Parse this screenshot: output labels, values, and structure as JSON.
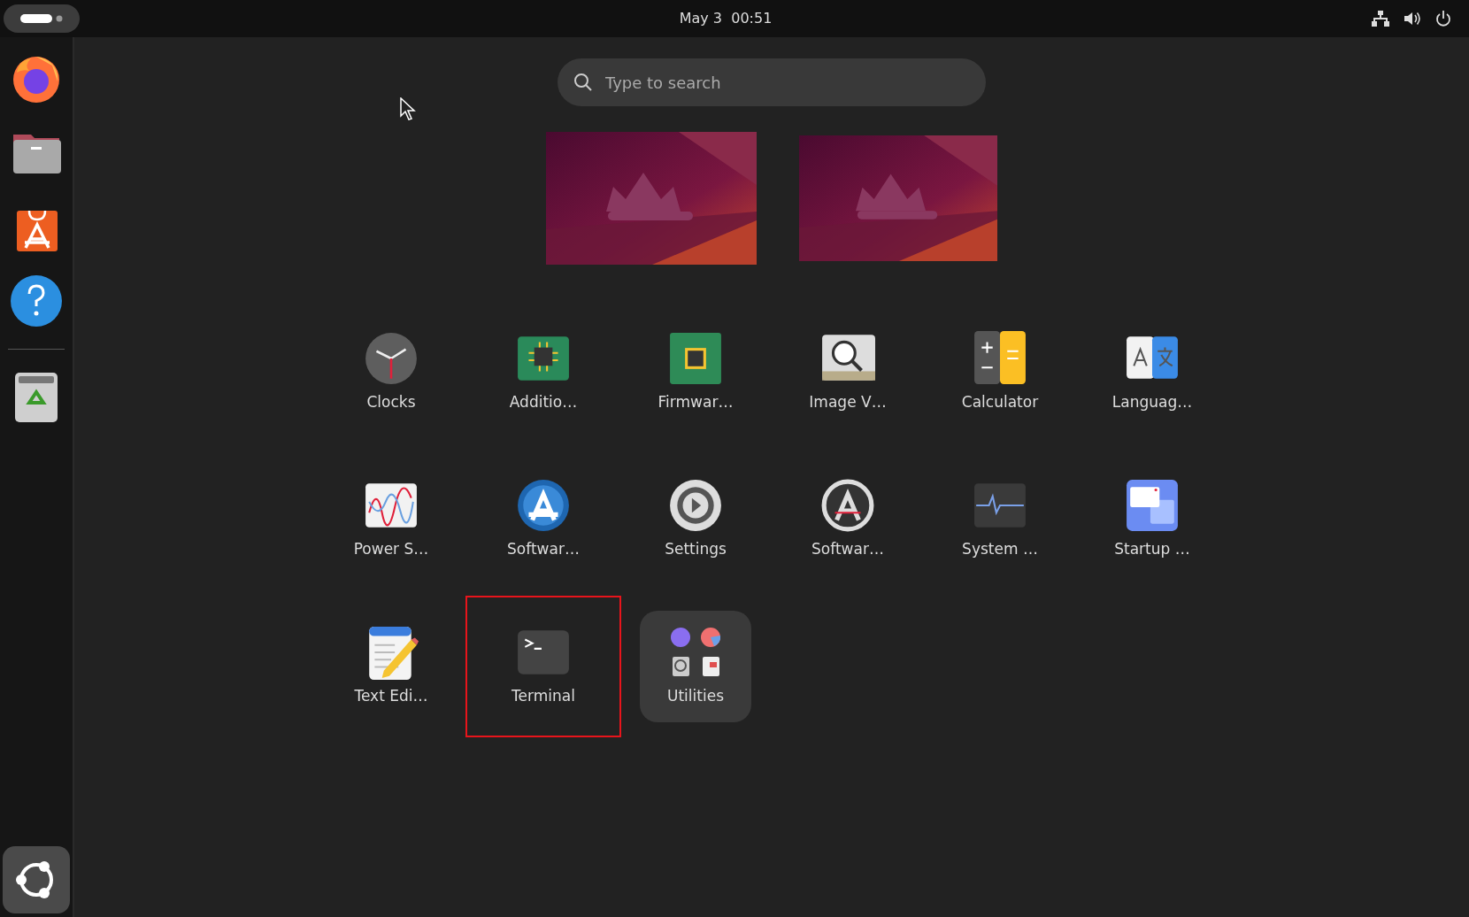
{
  "top_bar": {
    "clock": "May 3  00:51"
  },
  "search": {
    "placeholder": "Type to search"
  },
  "apps": [
    {
      "kind": "app",
      "label": "Clocks",
      "highlighted": false
    },
    {
      "kind": "app",
      "label": "Additio…",
      "highlighted": false
    },
    {
      "kind": "app",
      "label": "Firmwar…",
      "highlighted": false
    },
    {
      "kind": "app",
      "label": "Image V…",
      "highlighted": false
    },
    {
      "kind": "app",
      "label": "Calculator",
      "highlighted": false
    },
    {
      "kind": "app",
      "label": "Languag…",
      "highlighted": false
    },
    {
      "kind": "app",
      "label": "Power S…",
      "highlighted": false
    },
    {
      "kind": "app",
      "label": "Softwar…",
      "highlighted": false
    },
    {
      "kind": "app",
      "label": "Settings",
      "highlighted": false
    },
    {
      "kind": "app",
      "label": "Softwar…",
      "highlighted": false
    },
    {
      "kind": "app",
      "label": "System …",
      "highlighted": false
    },
    {
      "kind": "app",
      "label": "Startup …",
      "highlighted": false
    },
    {
      "kind": "app",
      "label": "Text Edi…",
      "highlighted": false
    },
    {
      "kind": "app",
      "label": "Terminal",
      "highlighted": true
    },
    {
      "kind": "folder",
      "label": "Utilities",
      "highlighted": false
    }
  ]
}
